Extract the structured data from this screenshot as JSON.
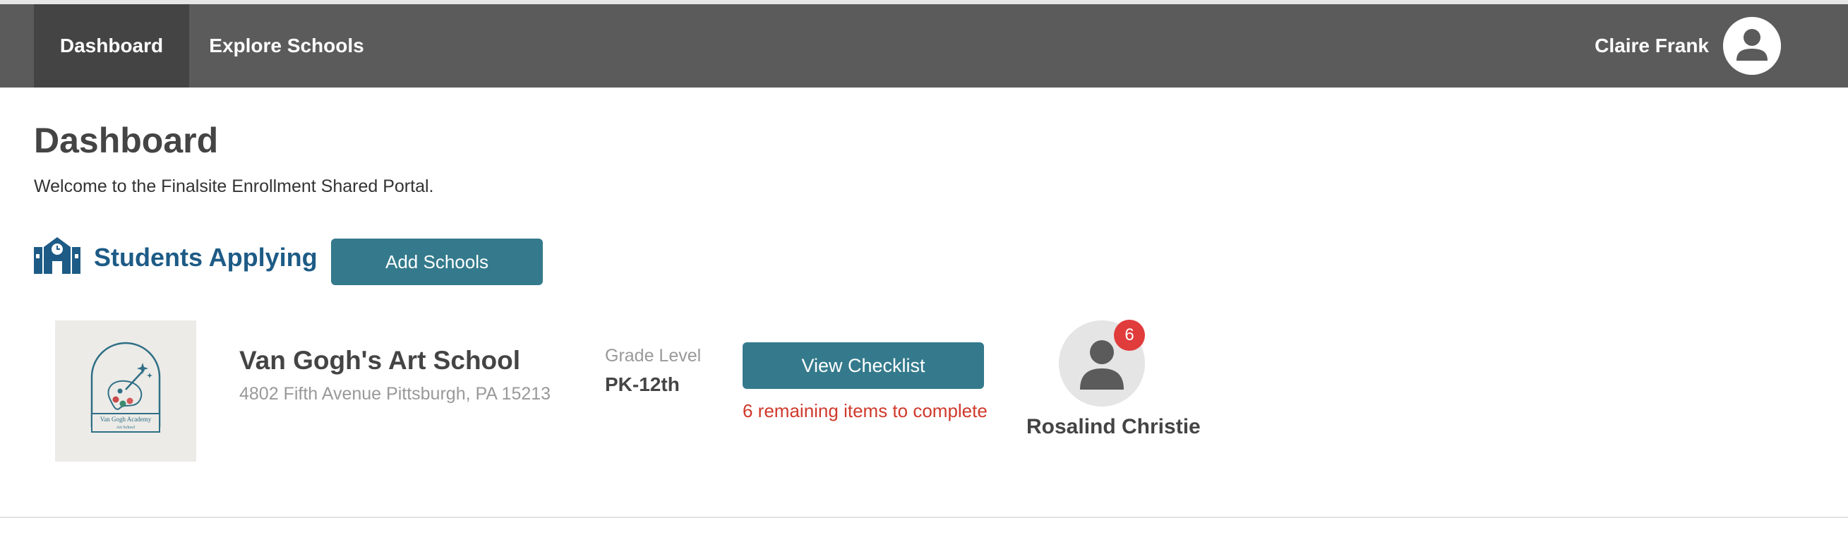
{
  "nav": {
    "dashboard_label": "Dashboard",
    "explore_label": "Explore Schools",
    "user_name": "Claire Frank",
    "avatar_icon": "user-avatar-icon"
  },
  "page": {
    "title": "Dashboard",
    "welcome": "Welcome to the Finalsite Enrollment Shared Portal."
  },
  "section": {
    "icon": "school-building-icon",
    "title": "Students Applying",
    "add_button": "Add Schools"
  },
  "application": {
    "school": {
      "name": "Van Gogh's Art School",
      "address": "4802 Fifth Avenue Pittsburgh, PA 15213",
      "logo_text": "Van Gogh Academy",
      "logo_subtext": "Art School"
    },
    "grade": {
      "label": "Grade Level",
      "value": "PK-12th"
    },
    "checklist_button": "View Checklist",
    "remaining_text": "6 remaining items to complete",
    "student": {
      "name": "Rosalind Christie",
      "badge_count": "6"
    }
  },
  "colors": {
    "nav_bg": "#5b5b5b",
    "nav_active_bg": "#444444",
    "accent": "#347a8c",
    "heading_blue": "#1d5b86",
    "alert_red": "#d0392b",
    "badge_red": "#e03c3c"
  }
}
